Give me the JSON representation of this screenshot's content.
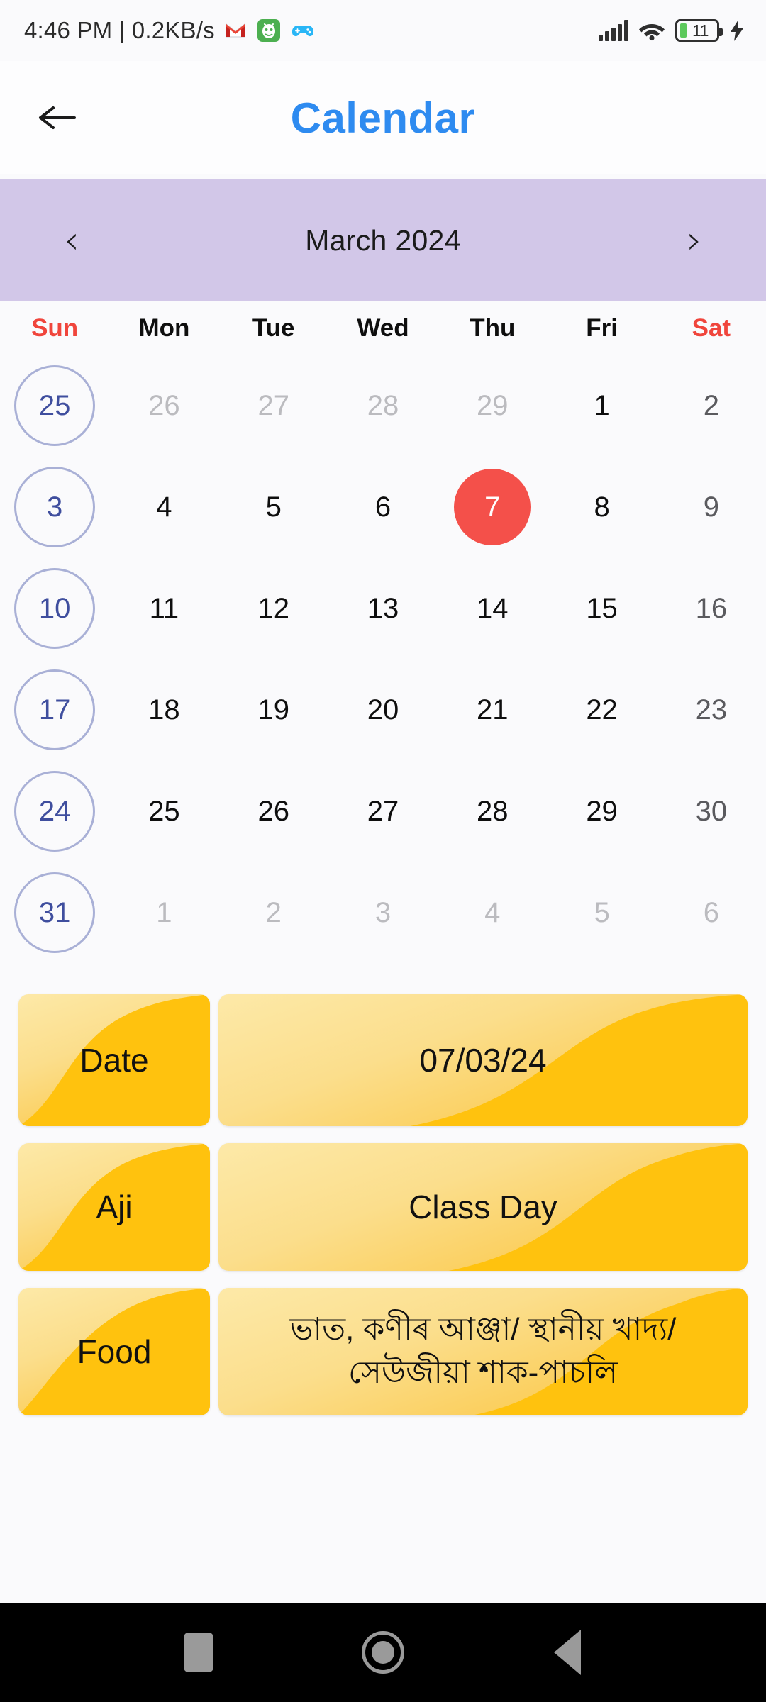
{
  "status_bar": {
    "clock": "4:46 PM | 0.2KB/s",
    "battery_level": "11",
    "icons": [
      "gmail-icon",
      "green-app-icon",
      "gamepad-icon",
      "signal-icon",
      "wifi-icon",
      "battery-icon",
      "charging-bolt-icon"
    ]
  },
  "app_bar": {
    "title": "Calendar",
    "back_icon": "back-arrow-icon"
  },
  "month_bar": {
    "prev_label": "‹",
    "month_label": "March 2024",
    "next_label": "›"
  },
  "calendar": {
    "weekdays": [
      "Sun",
      "Mon",
      "Tue",
      "Wed",
      "Thu",
      "Fri",
      "Sat"
    ],
    "weeks": [
      [
        {
          "n": "25",
          "state": "sun-ring"
        },
        {
          "n": "26",
          "state": "muted"
        },
        {
          "n": "27",
          "state": "muted"
        },
        {
          "n": "28",
          "state": "muted"
        },
        {
          "n": "29",
          "state": "muted"
        },
        {
          "n": "1",
          "state": "normal"
        },
        {
          "n": "2",
          "state": "sat"
        }
      ],
      [
        {
          "n": "3",
          "state": "sun-ring"
        },
        {
          "n": "4",
          "state": "normal"
        },
        {
          "n": "5",
          "state": "normal"
        },
        {
          "n": "6",
          "state": "normal"
        },
        {
          "n": "7",
          "state": "selected"
        },
        {
          "n": "8",
          "state": "normal"
        },
        {
          "n": "9",
          "state": "sat"
        }
      ],
      [
        {
          "n": "10",
          "state": "sun-ring"
        },
        {
          "n": "11",
          "state": "normal"
        },
        {
          "n": "12",
          "state": "normal"
        },
        {
          "n": "13",
          "state": "normal"
        },
        {
          "n": "14",
          "state": "normal"
        },
        {
          "n": "15",
          "state": "normal"
        },
        {
          "n": "16",
          "state": "sat"
        }
      ],
      [
        {
          "n": "17",
          "state": "sun-ring"
        },
        {
          "n": "18",
          "state": "normal"
        },
        {
          "n": "19",
          "state": "normal"
        },
        {
          "n": "20",
          "state": "normal"
        },
        {
          "n": "21",
          "state": "normal"
        },
        {
          "n": "22",
          "state": "normal"
        },
        {
          "n": "23",
          "state": "sat"
        }
      ],
      [
        {
          "n": "24",
          "state": "sun-ring"
        },
        {
          "n": "25",
          "state": "normal"
        },
        {
          "n": "26",
          "state": "normal"
        },
        {
          "n": "27",
          "state": "normal"
        },
        {
          "n": "28",
          "state": "normal"
        },
        {
          "n": "29",
          "state": "normal"
        },
        {
          "n": "30",
          "state": "sat"
        }
      ],
      [
        {
          "n": "31",
          "state": "sun-ring"
        },
        {
          "n": "1",
          "state": "muted"
        },
        {
          "n": "2",
          "state": "muted"
        },
        {
          "n": "3",
          "state": "muted"
        },
        {
          "n": "4",
          "state": "muted"
        },
        {
          "n": "5",
          "state": "muted"
        },
        {
          "n": "6",
          "state": "muted"
        }
      ]
    ]
  },
  "info": {
    "date_label": "Date",
    "date_value": "07/03/24",
    "aji_label": "Aji",
    "aji_value": "Class Day",
    "food_label": "Food",
    "food_value": "ভাত, কণীৰ আঞ্জা/ স্থানীয় খাদ্য/ সেউজীয়া শাক-পাচলি"
  },
  "nav_bar": {
    "recents_icon": "square-recents-icon",
    "home_icon": "circle-home-icon",
    "back_icon": "triangle-back-icon"
  },
  "colors": {
    "accent_blue": "#2E8BF0",
    "month_bar": "#D2C7E8",
    "selected_day": "#F4504A",
    "weekend_red": "#F0453C",
    "card_amber": "#FBC02D",
    "sunday_ring": "#A9B0D6"
  }
}
